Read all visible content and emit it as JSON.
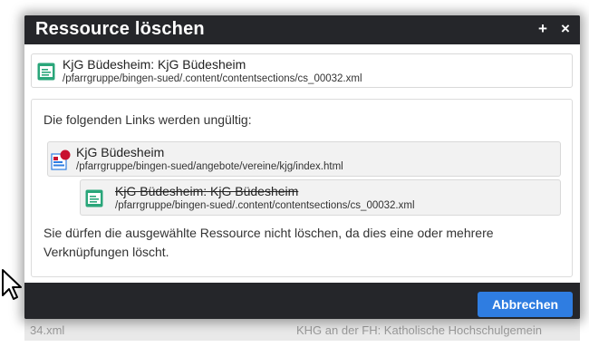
{
  "dialog": {
    "title": "Ressource löschen",
    "pin_symbol": "+",
    "close_symbol": "×"
  },
  "resource": {
    "title": "KjG Büdesheim: KjG Büdesheim",
    "path": "/pfarrgruppe/bingen-sued/.content/contentsections/cs_00032.xml",
    "icon": "content-section-icon"
  },
  "links_section": {
    "heading": "Die folgenden Links werden ungültig:",
    "items": [
      {
        "title": "KjG Büdesheim",
        "path": "/pfarrgruppe/bingen-sued/angebote/vereine/kjg/index.html",
        "icon": "page-icon-with-red-badge"
      },
      {
        "title": "KjG Büdesheim: KjG Büdesheim",
        "path": "/pfarrgruppe/bingen-sued/.content/contentsections/cs_00032.xml",
        "icon": "content-section-icon",
        "strikethrough": true
      }
    ],
    "warning": "Sie dürfen die ausgewählte Ressource nicht löschen, da dies eine oder mehrere Verknüpfungen löscht."
  },
  "footer": {
    "cancel_label": "Abbrechen"
  },
  "background": {
    "left_text": "34.xml",
    "right_text": "KHG an der FH: Katholische Hochschulgemein"
  },
  "colors": {
    "header_bg": "#25262a",
    "accent_button": "#2f7de1",
    "icon_green": "#2aa67a",
    "badge_red": "#c8102e"
  }
}
